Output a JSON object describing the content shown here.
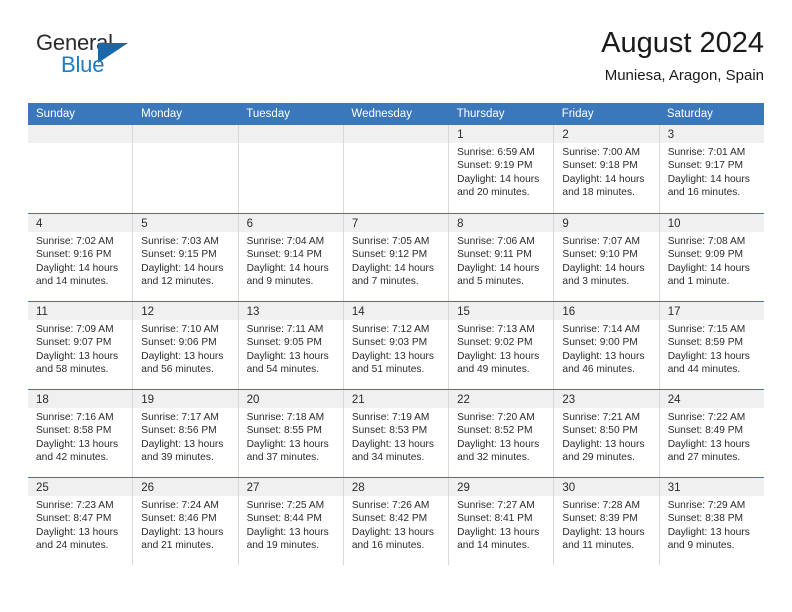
{
  "brand": {
    "name_top": "General",
    "name_bottom": "Blue",
    "accent_color": "#1f7cc4",
    "triangle_color": "#1769aa"
  },
  "header": {
    "title": "August 2024",
    "subtitle": "Muniesa, Aragon, Spain"
  },
  "calendar": {
    "header_color": "#3a77bb",
    "weekdays": [
      "Sunday",
      "Monday",
      "Tuesday",
      "Wednesday",
      "Thursday",
      "Friday",
      "Saturday"
    ],
    "weeks": [
      [
        {
          "day": "",
          "empty": true
        },
        {
          "day": "",
          "empty": true
        },
        {
          "day": "",
          "empty": true
        },
        {
          "day": "",
          "empty": true
        },
        {
          "day": "1",
          "sunrise": "Sunrise: 6:59 AM",
          "sunset": "Sunset: 9:19 PM",
          "daylight": "Daylight: 14 hours and 20 minutes."
        },
        {
          "day": "2",
          "sunrise": "Sunrise: 7:00 AM",
          "sunset": "Sunset: 9:18 PM",
          "daylight": "Daylight: 14 hours and 18 minutes."
        },
        {
          "day": "3",
          "sunrise": "Sunrise: 7:01 AM",
          "sunset": "Sunset: 9:17 PM",
          "daylight": "Daylight: 14 hours and 16 minutes."
        }
      ],
      [
        {
          "day": "4",
          "sunrise": "Sunrise: 7:02 AM",
          "sunset": "Sunset: 9:16 PM",
          "daylight": "Daylight: 14 hours and 14 minutes."
        },
        {
          "day": "5",
          "sunrise": "Sunrise: 7:03 AM",
          "sunset": "Sunset: 9:15 PM",
          "daylight": "Daylight: 14 hours and 12 minutes."
        },
        {
          "day": "6",
          "sunrise": "Sunrise: 7:04 AM",
          "sunset": "Sunset: 9:14 PM",
          "daylight": "Daylight: 14 hours and 9 minutes."
        },
        {
          "day": "7",
          "sunrise": "Sunrise: 7:05 AM",
          "sunset": "Sunset: 9:12 PM",
          "daylight": "Daylight: 14 hours and 7 minutes."
        },
        {
          "day": "8",
          "sunrise": "Sunrise: 7:06 AM",
          "sunset": "Sunset: 9:11 PM",
          "daylight": "Daylight: 14 hours and 5 minutes."
        },
        {
          "day": "9",
          "sunrise": "Sunrise: 7:07 AM",
          "sunset": "Sunset: 9:10 PM",
          "daylight": "Daylight: 14 hours and 3 minutes."
        },
        {
          "day": "10",
          "sunrise": "Sunrise: 7:08 AM",
          "sunset": "Sunset: 9:09 PM",
          "daylight": "Daylight: 14 hours and 1 minute."
        }
      ],
      [
        {
          "day": "11",
          "sunrise": "Sunrise: 7:09 AM",
          "sunset": "Sunset: 9:07 PM",
          "daylight": "Daylight: 13 hours and 58 minutes."
        },
        {
          "day": "12",
          "sunrise": "Sunrise: 7:10 AM",
          "sunset": "Sunset: 9:06 PM",
          "daylight": "Daylight: 13 hours and 56 minutes."
        },
        {
          "day": "13",
          "sunrise": "Sunrise: 7:11 AM",
          "sunset": "Sunset: 9:05 PM",
          "daylight": "Daylight: 13 hours and 54 minutes."
        },
        {
          "day": "14",
          "sunrise": "Sunrise: 7:12 AM",
          "sunset": "Sunset: 9:03 PM",
          "daylight": "Daylight: 13 hours and 51 minutes."
        },
        {
          "day": "15",
          "sunrise": "Sunrise: 7:13 AM",
          "sunset": "Sunset: 9:02 PM",
          "daylight": "Daylight: 13 hours and 49 minutes."
        },
        {
          "day": "16",
          "sunrise": "Sunrise: 7:14 AM",
          "sunset": "Sunset: 9:00 PM",
          "daylight": "Daylight: 13 hours and 46 minutes."
        },
        {
          "day": "17",
          "sunrise": "Sunrise: 7:15 AM",
          "sunset": "Sunset: 8:59 PM",
          "daylight": "Daylight: 13 hours and 44 minutes."
        }
      ],
      [
        {
          "day": "18",
          "sunrise": "Sunrise: 7:16 AM",
          "sunset": "Sunset: 8:58 PM",
          "daylight": "Daylight: 13 hours and 42 minutes."
        },
        {
          "day": "19",
          "sunrise": "Sunrise: 7:17 AM",
          "sunset": "Sunset: 8:56 PM",
          "daylight": "Daylight: 13 hours and 39 minutes."
        },
        {
          "day": "20",
          "sunrise": "Sunrise: 7:18 AM",
          "sunset": "Sunset: 8:55 PM",
          "daylight": "Daylight: 13 hours and 37 minutes."
        },
        {
          "day": "21",
          "sunrise": "Sunrise: 7:19 AM",
          "sunset": "Sunset: 8:53 PM",
          "daylight": "Daylight: 13 hours and 34 minutes."
        },
        {
          "day": "22",
          "sunrise": "Sunrise: 7:20 AM",
          "sunset": "Sunset: 8:52 PM",
          "daylight": "Daylight: 13 hours and 32 minutes."
        },
        {
          "day": "23",
          "sunrise": "Sunrise: 7:21 AM",
          "sunset": "Sunset: 8:50 PM",
          "daylight": "Daylight: 13 hours and 29 minutes."
        },
        {
          "day": "24",
          "sunrise": "Sunrise: 7:22 AM",
          "sunset": "Sunset: 8:49 PM",
          "daylight": "Daylight: 13 hours and 27 minutes."
        }
      ],
      [
        {
          "day": "25",
          "sunrise": "Sunrise: 7:23 AM",
          "sunset": "Sunset: 8:47 PM",
          "daylight": "Daylight: 13 hours and 24 minutes."
        },
        {
          "day": "26",
          "sunrise": "Sunrise: 7:24 AM",
          "sunset": "Sunset: 8:46 PM",
          "daylight": "Daylight: 13 hours and 21 minutes."
        },
        {
          "day": "27",
          "sunrise": "Sunrise: 7:25 AM",
          "sunset": "Sunset: 8:44 PM",
          "daylight": "Daylight: 13 hours and 19 minutes."
        },
        {
          "day": "28",
          "sunrise": "Sunrise: 7:26 AM",
          "sunset": "Sunset: 8:42 PM",
          "daylight": "Daylight: 13 hours and 16 minutes."
        },
        {
          "day": "29",
          "sunrise": "Sunrise: 7:27 AM",
          "sunset": "Sunset: 8:41 PM",
          "daylight": "Daylight: 13 hours and 14 minutes."
        },
        {
          "day": "30",
          "sunrise": "Sunrise: 7:28 AM",
          "sunset": "Sunset: 8:39 PM",
          "daylight": "Daylight: 13 hours and 11 minutes."
        },
        {
          "day": "31",
          "sunrise": "Sunrise: 7:29 AM",
          "sunset": "Sunset: 8:38 PM",
          "daylight": "Daylight: 13 hours and 9 minutes."
        }
      ]
    ]
  }
}
